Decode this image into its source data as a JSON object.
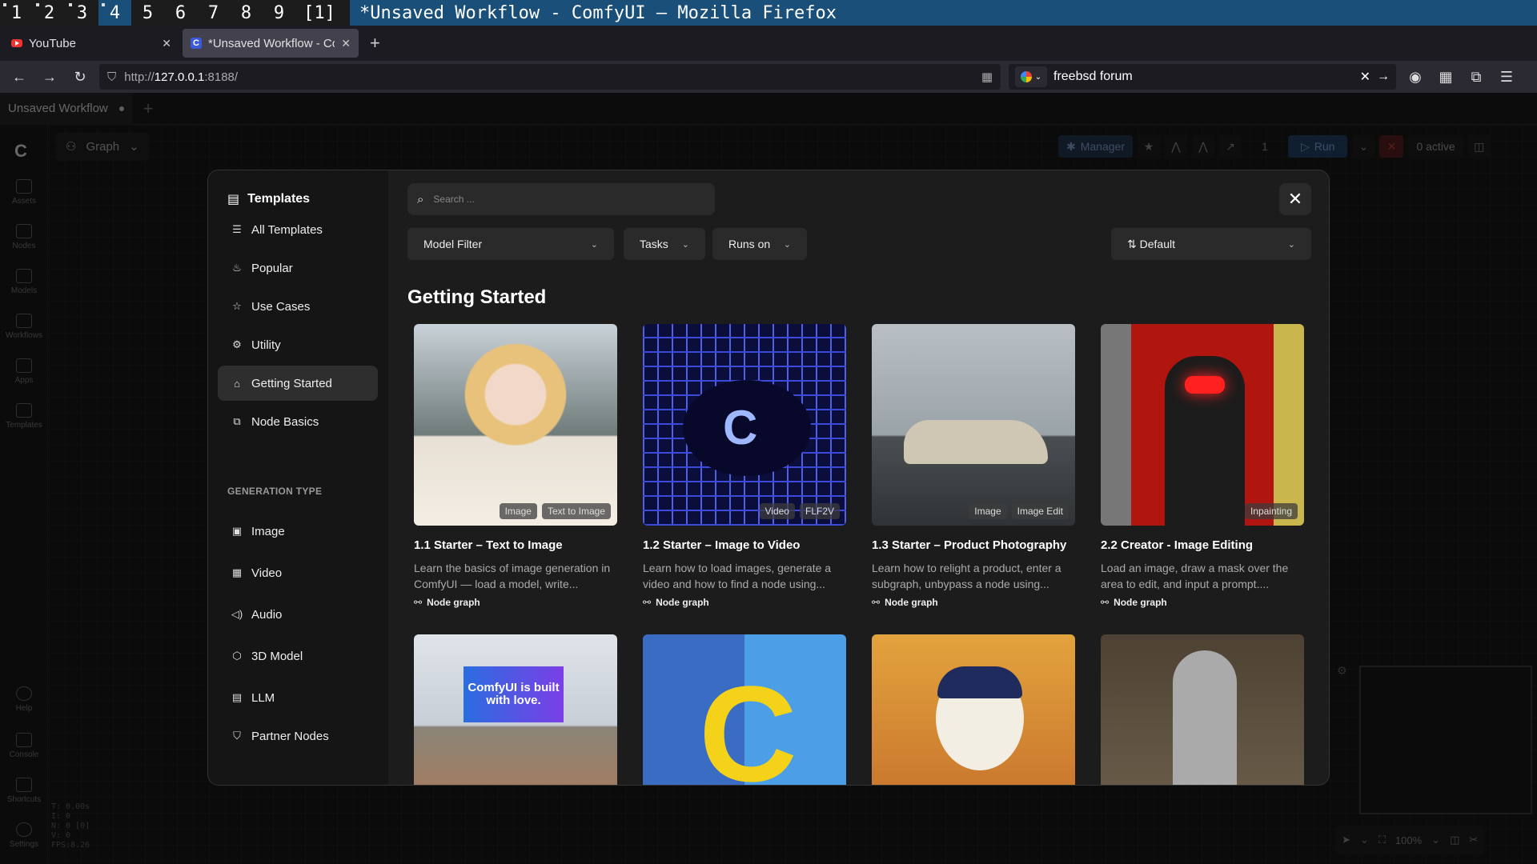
{
  "wm": {
    "workspaces": [
      "1",
      "2",
      "3",
      "4",
      "5",
      "6",
      "7",
      "8",
      "9",
      "[1]"
    ],
    "title": "*Unsaved Workflow - ComfyUI — Mozilla Firefox"
  },
  "browser": {
    "tabs": [
      {
        "label": "YouTube",
        "icon": "youtube-icon"
      },
      {
        "label": "*Unsaved Workflow - Con",
        "icon": "comfyui-icon"
      }
    ],
    "url_prefix": "http://",
    "url_host": "127.0.0.1",
    "url_rest": ":8188/",
    "search_query": "freebsd forum"
  },
  "comfy": {
    "workflow_tab": "Unsaved Workflow",
    "graph_label": "Graph",
    "sidebar": [
      "Assets",
      "Nodes",
      "Models",
      "Workflows",
      "Apps",
      "Templates",
      "Help",
      "Console",
      "Shortcuts",
      "Settings"
    ],
    "stats": [
      "T: 0.00s",
      "I: 0",
      "N: 0 [0]",
      "V: 0",
      "FPS:8.26"
    ],
    "actionbar": {
      "manager": "Manager",
      "queue_count": "1",
      "run": "Run",
      "active": "0 active"
    },
    "zoom": "100%"
  },
  "templates": {
    "title": "Templates",
    "search_placeholder": "Search ...",
    "nav": [
      "All Templates",
      "Popular",
      "Use Cases",
      "Utility",
      "Getting Started",
      "Node Basics"
    ],
    "selected_nav": "Getting Started",
    "generation_type_header": "GENERATION TYPE",
    "gen_types": [
      "Image",
      "Video",
      "Audio",
      "3D Model",
      "LLM",
      "Partner Nodes"
    ],
    "filters": {
      "model": "Model Filter",
      "tasks": "Tasks",
      "runs_on": "Runs on",
      "sort": "Default"
    },
    "section_title": "Getting Started",
    "cards": [
      {
        "title": "1.1 Starter – Text to Image",
        "desc": "Learn the basics of image generation in ComfyUI — load a model, write...",
        "tags": [
          "Image",
          "Text to Image"
        ],
        "footer": "Node graph"
      },
      {
        "title": "1.2 Starter – Image to Video",
        "desc": "Learn how to load images, generate a video and how to find a node using...",
        "tags": [
          "Video",
          "FLF2V"
        ],
        "footer": "Node graph"
      },
      {
        "title": "1.3 Starter – Product Photography",
        "desc": "Learn how to relight a product, enter a subgraph, unbypass a node using...",
        "tags": [
          "Image",
          "Image Edit"
        ],
        "footer": "Node graph"
      },
      {
        "title": "2.2 Creator - Image Editing",
        "desc": "Load an image, draw a mask over the area to edit, and input a prompt....",
        "tags": [
          "Inpainting"
        ],
        "footer": "Node graph"
      }
    ],
    "billboard_text": "ComfyUI is built with love."
  }
}
